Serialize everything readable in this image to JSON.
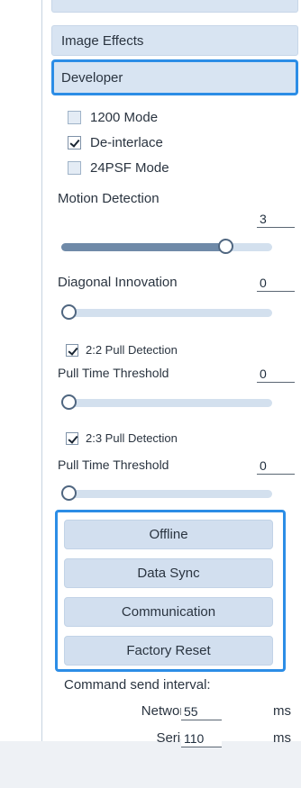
{
  "sections": {
    "image_effects": "Image Effects",
    "developer": "Developer"
  },
  "developer": {
    "mode_1200": "1200 Mode",
    "deinterlace": "De-interlace",
    "psf24": "24PSF Mode",
    "motion_detection": {
      "label": "Motion Detection",
      "value": "3",
      "level": 0.8
    },
    "diagonal_innovation": {
      "label": "Diagonal Innovation",
      "value": "0",
      "level": 0
    },
    "pull_22": {
      "label": "2:2 Pull Detection",
      "threshold_label": "Pull Time Threshold",
      "value": "0",
      "level": 0
    },
    "pull_23": {
      "label": "2:3 Pull Detection",
      "threshold_label": "Pull Time Threshold",
      "value": "0",
      "level": 0
    }
  },
  "actions": {
    "offline": "Offline",
    "data_sync": "Data Sync",
    "communication": "Communication",
    "factory_reset": "Factory Reset"
  },
  "command": {
    "title": "Command send interval:",
    "network_label": "Network port:",
    "network_value": "55",
    "serial_label": "Serial port:",
    "serial_value": "110",
    "unit": "ms"
  },
  "colors": {
    "accent": "#2c8de6",
    "button_bg": "#d8e4f2"
  }
}
